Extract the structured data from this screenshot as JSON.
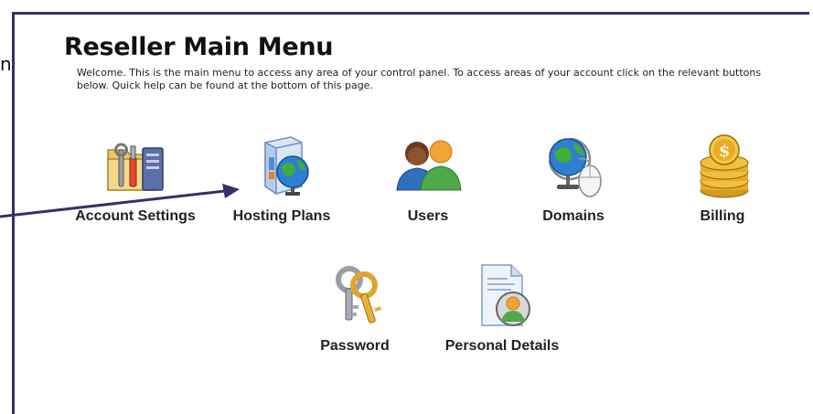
{
  "stray": {
    "char": "n"
  },
  "header": {
    "title": "Reseller Main Menu",
    "intro": "Welcome. This is the main menu to access any area of your control panel. To access areas of your account click on the relevant buttons below. Quick help can be found at the bottom of this page."
  },
  "menu": {
    "items": [
      {
        "label": "Account Settings",
        "icon": "tools-folder-icon"
      },
      {
        "label": "Hosting Plans",
        "icon": "box-globe-icon"
      },
      {
        "label": "Users",
        "icon": "users-icon"
      },
      {
        "label": "Domains",
        "icon": "globe-mouse-icon"
      },
      {
        "label": "Billing",
        "icon": "gold-coins-icon"
      },
      {
        "label": "Password",
        "icon": "keys-icon"
      },
      {
        "label": "Personal Details",
        "icon": "profile-document-icon"
      }
    ]
  },
  "colors": {
    "border": "#3b2d6b",
    "arrow": "#3b2d6b"
  }
}
